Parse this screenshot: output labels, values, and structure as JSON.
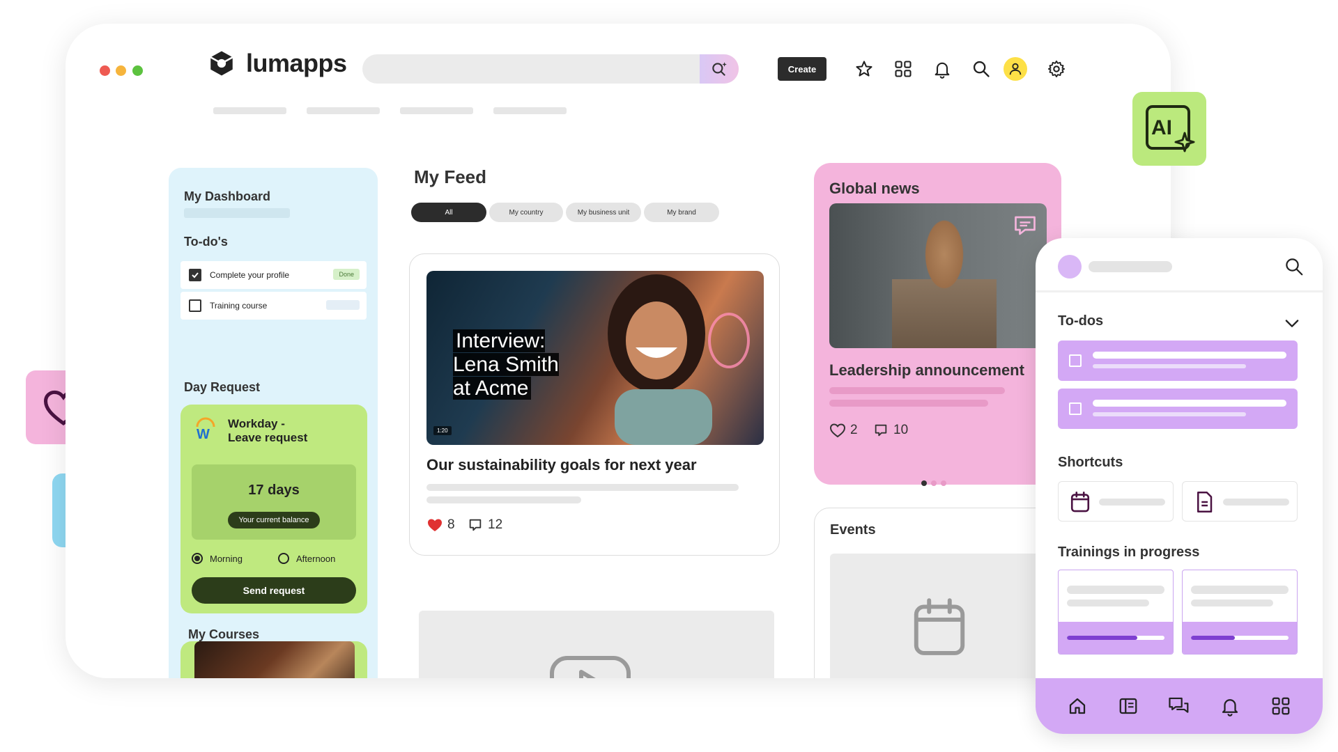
{
  "window": {
    "controls": [
      {
        "name": "close",
        "color": "#ee5a52"
      },
      {
        "name": "minimize",
        "color": "#f6b43c"
      },
      {
        "name": "maximize",
        "color": "#5cc23f"
      }
    ]
  },
  "header": {
    "logo_text": "lumapps",
    "search_ai_icon": "sparkle-search-icon",
    "create_label": "Create",
    "icons": [
      "star-icon",
      "grid-icon",
      "bell-icon",
      "search-icon",
      "user-icon",
      "gear-icon"
    ]
  },
  "dashboard": {
    "title": "My Dashboard",
    "todos_title": "To-do's",
    "todos": [
      {
        "label": "Complete your profile",
        "checked": true,
        "badge": "Done"
      },
      {
        "label": "Training course",
        "checked": false,
        "badge": ""
      }
    ],
    "day_request": {
      "title": "Day Request",
      "app_name": "Workday -\nLeave request",
      "balance_value": "17 days",
      "balance_label": "Your current balance",
      "options": [
        {
          "label": "Morning",
          "selected": true
        },
        {
          "label": "Afternoon",
          "selected": false
        }
      ],
      "send_label": "Send request"
    },
    "courses_title": "My Courses"
  },
  "feed": {
    "title": "My Feed",
    "filters": [
      {
        "label": "All",
        "active": true
      },
      {
        "label": "My country",
        "active": false
      },
      {
        "label": "My business unit",
        "active": false
      },
      {
        "label": "My brand",
        "active": false
      }
    ],
    "post": {
      "video_overlay": "Interview:\nLena Smith\nat Acme",
      "video_time": "1:20",
      "title": "Our sustainability goals for next year",
      "likes": "8",
      "comments": "12"
    }
  },
  "global_news": {
    "title": "Global news",
    "headline": "Leadership announcement",
    "likes": "2",
    "comments": "10"
  },
  "events": {
    "title": "Events"
  },
  "mobile": {
    "todos_title": "To-dos",
    "shortcuts_title": "Shortcuts",
    "trainings_title": "Trainings in progress",
    "trainings_progress": [
      0.72,
      0.45
    ],
    "nav_icons": [
      "home-icon",
      "news-icon",
      "chat-icon",
      "bell-icon",
      "grid-icon"
    ]
  },
  "floating": {
    "ai_text": "AI"
  },
  "colors": {
    "dashboard_bg": "#dff3fb",
    "accent_green": "#bfe97f",
    "accent_pink": "#f4b4dc",
    "accent_purple": "#d3a8f5",
    "dark_green": "#2c3d1a"
  }
}
